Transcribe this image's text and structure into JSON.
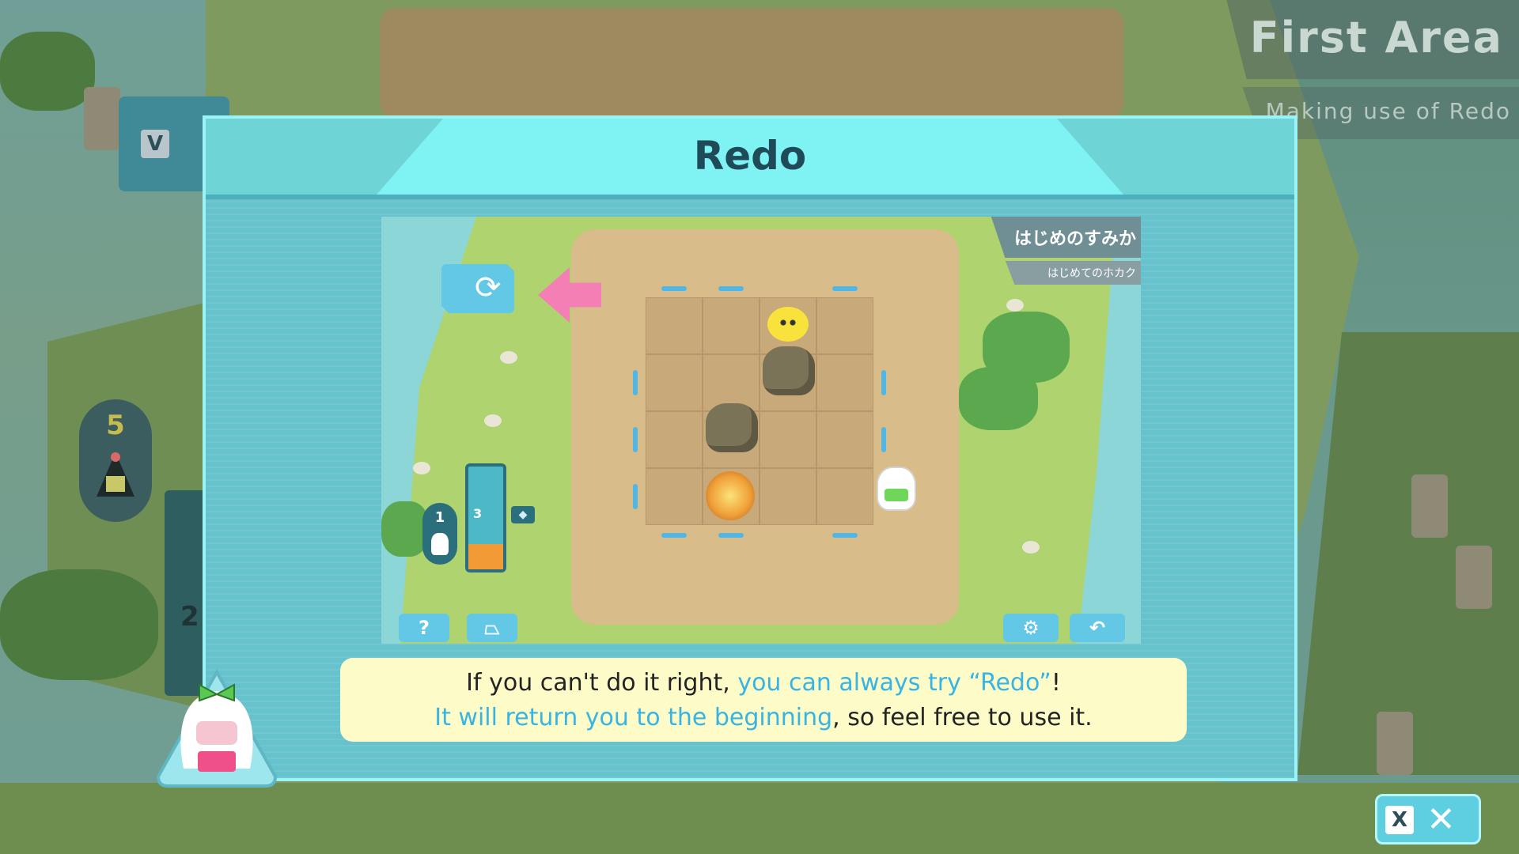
{
  "background": {
    "area_title": "First Area",
    "area_subtitle": "Making use of Redo",
    "v_key_label": "V",
    "remaining_count": "5",
    "energy_value": "2"
  },
  "dialog": {
    "title": "Redo",
    "preview": {
      "area_title": "はじめのすみか",
      "area_subtitle": "はじめてのホカク",
      "redo_icon": "redo-icon",
      "battery_value": "3",
      "battery_fill_fraction": 0.25,
      "count_value": "1",
      "help_label": "?",
      "settings_icon": "gear-icon",
      "undo_icon": "undo-icon"
    },
    "message": {
      "line1_plain": "If you can't do it right, ",
      "line1_highlight": "you can always try “Redo”",
      "line1_end": "!",
      "line2_highlight": "It will return you to the beginning",
      "line2_plain": ", so feel free to use it."
    }
  },
  "close_button": {
    "key_label": "X",
    "icon": "close-icon"
  },
  "colors": {
    "dialog_bg": "#66c2cc",
    "dialog_header": "#7ff3f3",
    "highlight_text": "#37b4e3",
    "speech_bg": "#fdfcc9",
    "pink_arrow": "#f47fb4"
  }
}
